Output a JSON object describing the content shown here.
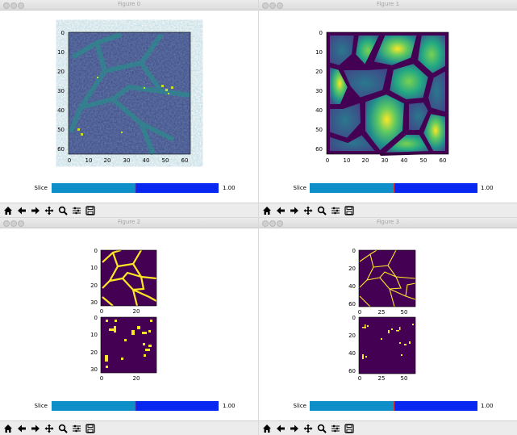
{
  "colors": {
    "cyan": "#0e8fc8",
    "blue": "#0828f2",
    "divider": "#cf3b3b",
    "viridis_dark": "#440154",
    "yellow": "#fde725"
  },
  "toolbar_icons": [
    "home-icon",
    "back-arrow-icon",
    "forward-arrow-icon",
    "pan-icon",
    "zoom-icon",
    "configure-subplots-icon",
    "save-icon"
  ],
  "windows": [
    {
      "title": "Figure 0",
      "slider": {
        "label": "Slice",
        "value": "1.00",
        "fraction": 0.49
      }
    },
    {
      "title": "Figure 1",
      "slider": {
        "label": "Slice",
        "value": "1.00",
        "fraction": 0.49
      }
    },
    {
      "title": "Figure 2",
      "slider": {
        "label": "Slice",
        "value": "1.00",
        "fraction": 0.49
      }
    },
    {
      "title": "Figure 3",
      "slider": {
        "label": "Slice",
        "value": "1.00",
        "fraction": 0.49
      }
    }
  ],
  "figure0_axes": {
    "xticks": [
      "0",
      "10",
      "20",
      "30",
      "40",
      "50",
      "60"
    ],
    "yticks": [
      "0",
      "10",
      "20",
      "30",
      "40",
      "50",
      "60"
    ]
  },
  "figure1_axes": {
    "xticks": [
      "0",
      "10",
      "20",
      "30",
      "40",
      "50",
      "60"
    ],
    "yticks": [
      "0",
      "10",
      "20",
      "30",
      "40",
      "50",
      "60"
    ]
  },
  "figure2_axes": {
    "top": {
      "xticks": [
        "0",
        "20"
      ],
      "yticks": [
        "0",
        "10",
        "20",
        "30"
      ]
    },
    "bottom": {
      "xticks": [
        "0",
        "20"
      ],
      "yticks": [
        "0",
        "10",
        "20",
        "30"
      ]
    }
  },
  "figure3_axes": {
    "top": {
      "xticks": [
        "0",
        "25",
        "50"
      ],
      "yticks": [
        "0",
        "20",
        "40",
        "60"
      ]
    },
    "bottom": {
      "xticks": [
        "0",
        "25",
        "50"
      ],
      "yticks": [
        "0",
        "20",
        "40",
        "60"
      ]
    }
  }
}
